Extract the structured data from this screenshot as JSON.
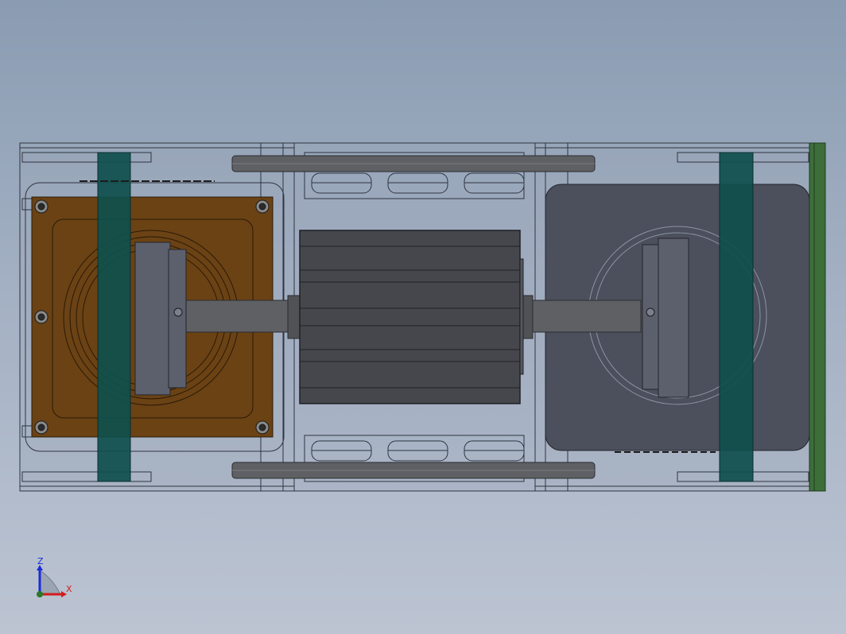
{
  "viewport": {
    "background_top": "#8a9cb2",
    "background_bottom": "#bcc4d2",
    "view_orientation": "front"
  },
  "model": {
    "colors": {
      "frame_line": "#2e3440",
      "frame_fill": "#9aa6b8",
      "brown_plate": "#6b4214",
      "teal_clamp": "#0f4f4d",
      "motor_body": "#46474d",
      "dark_housing": "#4c4f5c",
      "shaft": "#5e6064",
      "green_board": "#3d6e3a"
    },
    "parts": [
      "left-frame",
      "center-frame",
      "right-frame",
      "brown-mounting-plate",
      "left-teal-clamp",
      "right-teal-clamp",
      "center-motor",
      "main-shaft",
      "upper-tie-rod",
      "lower-tie-rod",
      "right-housing",
      "green-board"
    ]
  },
  "triad": {
    "z_label": "Z",
    "x_label": "X",
    "z_color": "#1a2bd6",
    "x_color": "#d41c1c",
    "origin_color": "#2a7a2a"
  }
}
